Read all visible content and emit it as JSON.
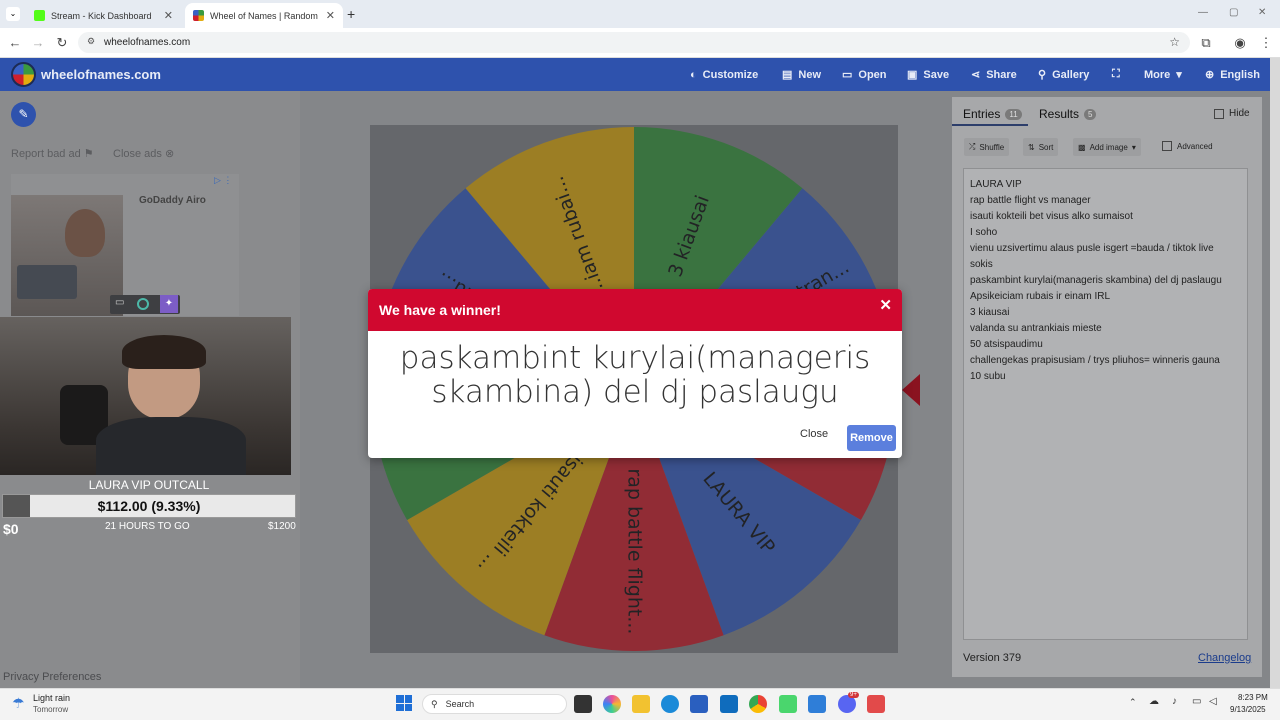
{
  "browser": {
    "tabs": [
      {
        "title": "Stream - Kick Dashboard",
        "active": false
      },
      {
        "title": "Wheel of Names | Random nam",
        "active": true
      }
    ],
    "new_tab": "+",
    "url": "wheelofnames.com",
    "window_controls": [
      "—",
      "▢",
      "✕"
    ]
  },
  "site": {
    "logo": "wheelofnames.com",
    "menu": [
      {
        "label": "Customize",
        "icon": "palette-icon"
      },
      {
        "label": "New",
        "icon": "file-icon"
      },
      {
        "label": "Open",
        "icon": "folder-icon"
      },
      {
        "label": "Save",
        "icon": "save-icon"
      },
      {
        "label": "Share",
        "icon": "share-icon"
      },
      {
        "label": "Gallery",
        "icon": "search-icon"
      },
      {
        "label": "",
        "icon": "fullscreen-icon"
      },
      {
        "label": "More",
        "icon": "chevron-down-icon"
      },
      {
        "label": "English",
        "icon": "globe-icon"
      }
    ]
  },
  "ads": {
    "report": "Report bad ad",
    "close": "Close ads",
    "brand": "GoDaddy Airo",
    "privacy": "Privacy Preferences"
  },
  "stream_overlay": {
    "goal_title": "LAURA VIP OUTCALL",
    "amount": "$112.00 (9.33%)",
    "progress_fraction": 0.0933,
    "start": "$0",
    "time_left": "21 HOURS TO GO",
    "target": "$1200"
  },
  "wheel": {
    "slices": [
      {
        "label": "3 kiausai",
        "color": "#3a9a3f"
      },
      {
        "label": "valanda su antrankiais mieste",
        "color": "#3961c4",
        "display": "...uda su antran..."
      },
      {
        "label": "50 atsispaudimu",
        "color": "#cf1f2c",
        "display": "50 atsispaudimu"
      },
      {
        "label": "LAURA VIP",
        "color": "#3961c4"
      },
      {
        "label": "rap battle flight vs manager",
        "color": "#cf1f2c",
        "display": "rap battle flight..."
      },
      {
        "label": "isauti kokteili bet visus alko sumaisot",
        "color": "#e2ac0f",
        "display": "isauti kokteili ..."
      },
      {
        "label": "I soho",
        "color": "#3a9a3f"
      },
      {
        "label": "vienu uzsivertimu alaus pusle isgert",
        "color": "#3961c4",
        "display": "...sivertimu..."
      },
      {
        "label": "Apsikeiciam rubais ir einam IRL",
        "color": "#e2ac0f",
        "display": "...iam rubai..."
      }
    ]
  },
  "modal": {
    "title": "We have a winner!",
    "winner": "paskambint kurylai(manageris skambina) del dj paslaugu",
    "close": "Close",
    "remove": "Remove"
  },
  "panel": {
    "tabs": [
      {
        "label": "Entries",
        "count": "11"
      },
      {
        "label": "Results",
        "count": "5"
      }
    ],
    "hide": "Hide",
    "tools": [
      "Shuffle",
      "Sort",
      "Add image",
      "Advanced"
    ],
    "entries": [
      "LAURA VIP",
      "rap battle flight vs manager",
      "isauti kokteili bet visus alko sumaisot",
      "I soho",
      "vienu uzsivertimu alaus pusle isgert =bauda / tiktok live",
      "sokis",
      "paskambint kurylai(manageris skambina) del dj paslaugu",
      "Apsikeiciam rubais ir einam IRL",
      "3 kiausai",
      "valanda su antrankiais mieste",
      "50 atsispaudimu",
      "challengekas prapisusiam / trys pliuhos= winneris gauna",
      "10 subu"
    ],
    "version": "Version 379",
    "changelog": "Changelog"
  },
  "taskbar": {
    "weather": "Light rain",
    "weather_sub": "Tomorrow",
    "search": "Search",
    "time": "8:23 PM",
    "date": "9/13/2025",
    "discord_badge": "9+"
  }
}
